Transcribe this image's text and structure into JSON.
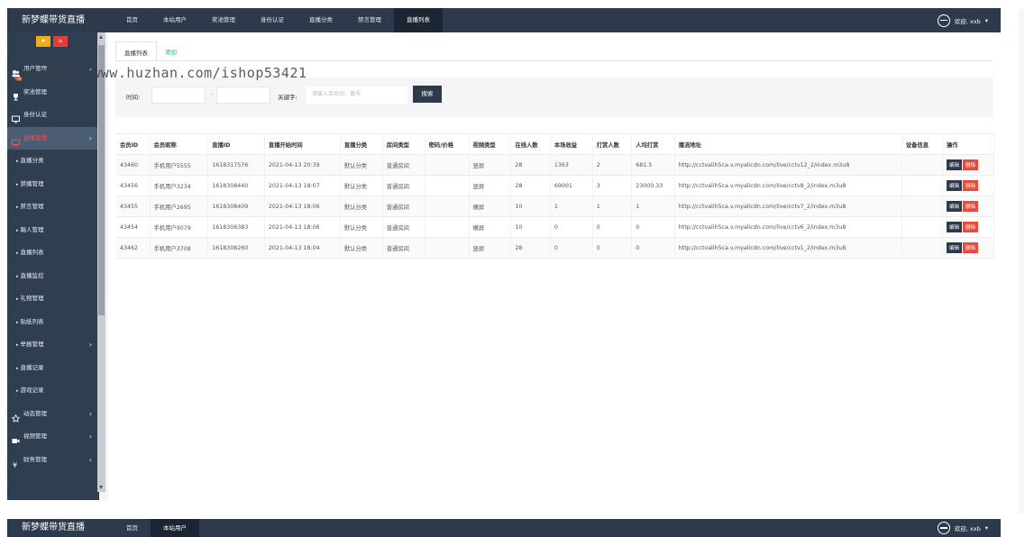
{
  "brand": "新梦蝶带货直播",
  "topnav": {
    "items": [
      "首页",
      "本站用户",
      "奖池管理",
      "身份认证",
      "直播分类",
      "禁言管理",
      "直播列表"
    ],
    "active_index": 6,
    "user_text": "欢迎, xxb"
  },
  "sidebar": {
    "quick_buttons": [
      {
        "icon": "star-icon",
        "color": "#f0ad1c"
      },
      {
        "icon": "home-icon",
        "color": "#e23c3c"
      }
    ],
    "items": [
      {
        "label": "用户管理",
        "icon": "users-icon",
        "expandable": true
      },
      {
        "label": "奖池管理",
        "icon": "trophy-icon",
        "expandable": false
      },
      {
        "label": "身份认证",
        "icon": "monitor-icon",
        "expandable": false
      },
      {
        "label": "直播管理",
        "icon": "screen-icon",
        "expandable": true,
        "active": true
      },
      {
        "label": "直播分类",
        "sub": true
      },
      {
        "label": "禁播管理",
        "sub": true
      },
      {
        "label": "禁言管理",
        "sub": true
      },
      {
        "label": "踢人管理",
        "sub": true
      },
      {
        "label": "直播列表",
        "sub": true
      },
      {
        "label": "直播监控",
        "sub": true
      },
      {
        "label": "礼物管理",
        "sub": true
      },
      {
        "label": "贴纸列表",
        "sub": true
      },
      {
        "label": "举报管理",
        "sub": true,
        "expandable": true
      },
      {
        "label": "直播记录",
        "sub": true
      },
      {
        "label": "游戏记录",
        "sub": true
      },
      {
        "label": "动态管理",
        "icon": "star-outline-icon",
        "expandable": true
      },
      {
        "label": "视频管理",
        "icon": "video-icon",
        "expandable": true
      },
      {
        "label": "财务管理",
        "icon": "yen-icon",
        "expandable": true
      }
    ]
  },
  "tabs": [
    {
      "label": "直播列表",
      "active": true
    },
    {
      "label": "添加",
      "active": false
    }
  ],
  "filter": {
    "time_label": "时间:",
    "dash": "-",
    "keyword_label": "关键字:",
    "keyword_placeholder": "请输入会员ID、靓号",
    "search_label": "搜索"
  },
  "table": {
    "columns": [
      "会员ID",
      "会员昵称",
      "直播ID",
      "直播开始时间",
      "直播分类",
      "房间类型",
      "密码/价格",
      "视频类型",
      "在线人数",
      "本场收益",
      "打赏人数",
      "人均打赏",
      "播流地址",
      "设备信息",
      "操作"
    ],
    "rows": [
      [
        "43460",
        "手机用户5555",
        "1618317576",
        "2021-04-13 20:39",
        "默认分类",
        "普通房间",
        "",
        "竖屏",
        "28",
        "1363",
        "2",
        "681.5",
        "http://cctvalih5ca.v.myalicdn.com/live/cctv12_2/index.m3u8",
        ""
      ],
      [
        "43456",
        "手机用户3234",
        "1618308440",
        "2021-04-13 18:07",
        "默认分类",
        "普通房间",
        "",
        "竖屏",
        "28",
        "69001",
        "3",
        "23000.33",
        "http://cctvalih5ca.v.myalicdn.com/live/cctv8_2/index.m3u8",
        ""
      ],
      [
        "43455",
        "手机用户2695",
        "1618308409",
        "2021-04-13 18:06",
        "默认分类",
        "普通房间",
        "",
        "横屏",
        "10",
        "1",
        "1",
        "1",
        "http://cctvalih5ca.v.myalicdn.com/live/cctv7_2/index.m3u8",
        ""
      ],
      [
        "43454",
        "手机用户9079",
        "1618308383",
        "2021-04-13 18:06",
        "默认分类",
        "普通房间",
        "",
        "横屏",
        "10",
        "0",
        "0",
        "0",
        "http://cctvalih5ca.v.myalicdn.com/live/cctv6_2/index.m3u8",
        ""
      ],
      [
        "43462",
        "手机用户3708",
        "1618308260",
        "2021-04-13 18:04",
        "默认分类",
        "普通房间",
        "",
        "竖屏",
        "28",
        "0",
        "0",
        "0",
        "http://cctvalih5ca.v.myalicdn.com/live/cctv1_2/index.m3u8",
        ""
      ]
    ],
    "edit_label": "编辑",
    "delete_label": "删除"
  },
  "watermark": "https://www.huzhan.com/ishop53421",
  "second_screen": {
    "brand": "新梦蝶带货直播",
    "items": [
      "首页",
      "本站用户"
    ],
    "active_index": 1,
    "user_text": "欢迎, xxb"
  },
  "colors": {
    "topbar": "#2c3a4b",
    "sidebar": "#2f3f51",
    "active_menu_text": "#ff4b4b",
    "add_tab": "#2bb673",
    "delete_button": "#e54c3c"
  }
}
